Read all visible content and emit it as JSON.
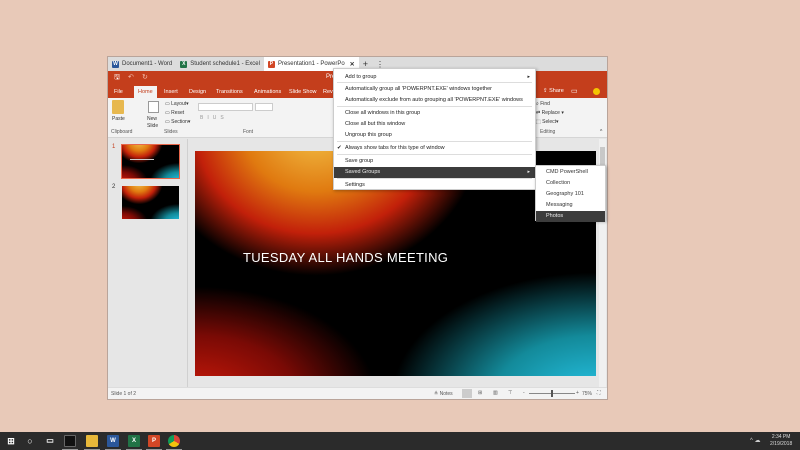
{
  "tabs": [
    {
      "label": "Document1 - Word",
      "app": "W",
      "color": "#2b579a"
    },
    {
      "label": "Student schedule1 - Excel",
      "app": "X",
      "color": "#217346"
    },
    {
      "label": "Presentation1 - PowerPo",
      "app": "P",
      "color": "#d24726"
    }
  ],
  "window_title": "Pre",
  "ribbon": {
    "tabs": [
      "File",
      "Home",
      "Insert",
      "Design",
      "Transitions",
      "Animations",
      "Slide Show",
      "Rev"
    ],
    "selected": "Home",
    "share": "Share",
    "clipboard": {
      "paste": "Paste",
      "label": "Clipboard"
    },
    "slides": {
      "new_slide": "New Slide",
      "layout": "Layout",
      "reset": "Reset",
      "section": "Section",
      "label": "Slides"
    },
    "font": {
      "label": "Font"
    },
    "editing": {
      "find": "Find",
      "replace": "Replace",
      "select": "Select",
      "label": "Editing"
    }
  },
  "slide": {
    "title": "TUESDAY ALL HANDS MEETING"
  },
  "thumbnails": [
    "1",
    "2"
  ],
  "status": {
    "slide": "Slide 1 of 2",
    "notes": "Notes",
    "zoom": "75%",
    "zoom_level": 0.5
  },
  "menu": {
    "items": [
      {
        "label": "Add to group",
        "submenu": true
      },
      {
        "label": "Automatically group all 'POWERPNT.EXE' windows together"
      },
      {
        "label": "Automatically exclude from auto grouping all 'POWERPNT.EXE' windows"
      },
      {
        "label": "Close all windows in this group"
      },
      {
        "label": "Close all but this window"
      },
      {
        "label": "Ungroup this group"
      },
      {
        "label": "Always show tabs for this type of window",
        "checked": true
      },
      {
        "label": "Save group"
      },
      {
        "label": "Saved Groups",
        "submenu": true,
        "highlighted": true
      },
      {
        "label": "Settings"
      }
    ],
    "check": "✔",
    "arrow": "▸"
  },
  "saved_groups": [
    "CMD  PowerShell",
    "Collection",
    "Geography 101",
    "Messaging",
    "Photos"
  ],
  "saved_groups_highlighted": "Photos",
  "taskbar": {
    "time": "2:34 PM",
    "date": "2/19/2018"
  }
}
